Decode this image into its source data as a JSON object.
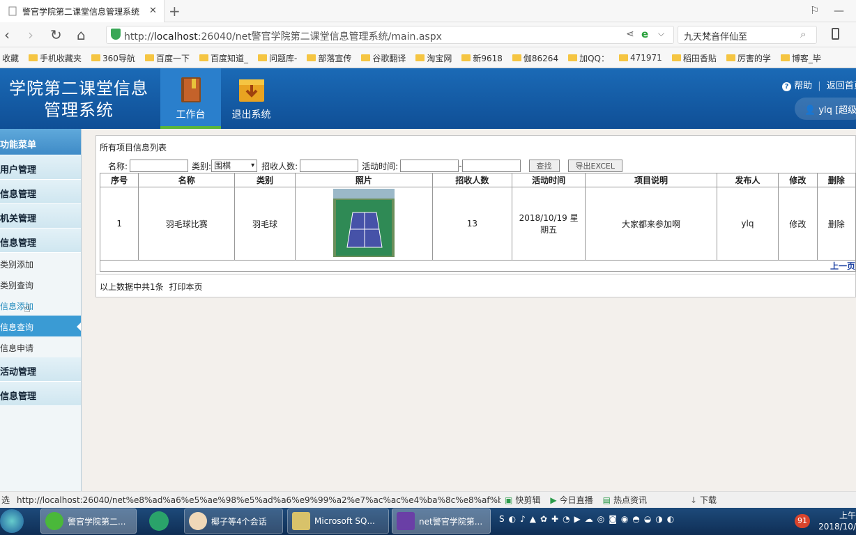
{
  "browser": {
    "tab_title": "警官学院第二课堂信息管理系统",
    "url_prefix": "http://",
    "url_host": "localhost",
    "url_rest": ":26040/net警官学院第二课堂信息管理系统/main.aspx",
    "search_text": "九天梵音伴仙至",
    "bookmarks": [
      "收藏",
      "手机收藏夹",
      "360导航",
      "百度一下",
      "百度知道_",
      "问题库-",
      "部落宣传",
      "谷歌翻译",
      "淘宝网",
      "新9618",
      "伽86264",
      "加QQ：",
      "471971",
      "稻田香贴",
      "厉害的学",
      "博客_毕"
    ]
  },
  "header": {
    "title_line1": "学院第二课堂信息",
    "title_line2": "管理系统",
    "nav_work": "工作台",
    "nav_exit": "退出系统",
    "help": "帮助",
    "home": "返回首页",
    "user": "ylq [超级"
  },
  "sidebar": {
    "head": "功能菜单",
    "items": [
      {
        "label": "用户管理",
        "type": "section"
      },
      {
        "label": "信息管理",
        "type": "section"
      },
      {
        "label": "机关管理",
        "type": "section"
      },
      {
        "label": "信息管理",
        "type": "section"
      },
      {
        "label": "类别添加",
        "type": "item"
      },
      {
        "label": "类别查询",
        "type": "item"
      },
      {
        "label": "信息添加",
        "type": "link"
      },
      {
        "label": "信息查询",
        "type": "active"
      },
      {
        "label": "信息申请",
        "type": "item"
      },
      {
        "label": "活动管理",
        "type": "section"
      },
      {
        "label": "信息管理",
        "type": "section"
      }
    ]
  },
  "main": {
    "list_title": "所有项目信息列表",
    "filter": {
      "name_label": "名称:",
      "category_label": "类别:",
      "category_value": "围棋",
      "count_label": "招收人数:",
      "time_label": "活动时间:",
      "time_sep": "-",
      "search_btn": "查找",
      "export_btn": "导出EXCEL"
    },
    "columns": [
      "序号",
      "名称",
      "类别",
      "照片",
      "招收人数",
      "活动时间",
      "项目说明",
      "发布人",
      "修改",
      "删除"
    ],
    "rows": [
      {
        "no": "1",
        "name": "羽毛球比赛",
        "category": "羽毛球",
        "count": "13",
        "time": "2018/10/19 星期五",
        "desc": "大家都来参加啊",
        "publisher": "ylq",
        "edit": "修改",
        "delete": "删除"
      }
    ],
    "pager_prev": "上一页",
    "summary": "以上数据中共1条",
    "print": "打印本页"
  },
  "status": {
    "left": "选",
    "url": "http://localhost:26040/net%e8%ad%a6%e5%ae%98%e5%ad%a6%e9%99%a2%e7%ac%ac%e4%ba%8c%e8%af%be%e",
    "items": [
      "快剪辑",
      "今日直播",
      "热点资讯",
      "下载"
    ]
  },
  "taskbar": {
    "tasks": [
      "警官学院第二...",
      "椰子等4个会话",
      "Microsoft SQ...",
      "net警官学院第..."
    ],
    "badge": "91",
    "time": "上午",
    "date": "2018/10/"
  },
  "colors": {
    "header_blue": "#1b6ab6",
    "active_menu": "#3a9bd4",
    "nav_green": "#5bb53a"
  }
}
